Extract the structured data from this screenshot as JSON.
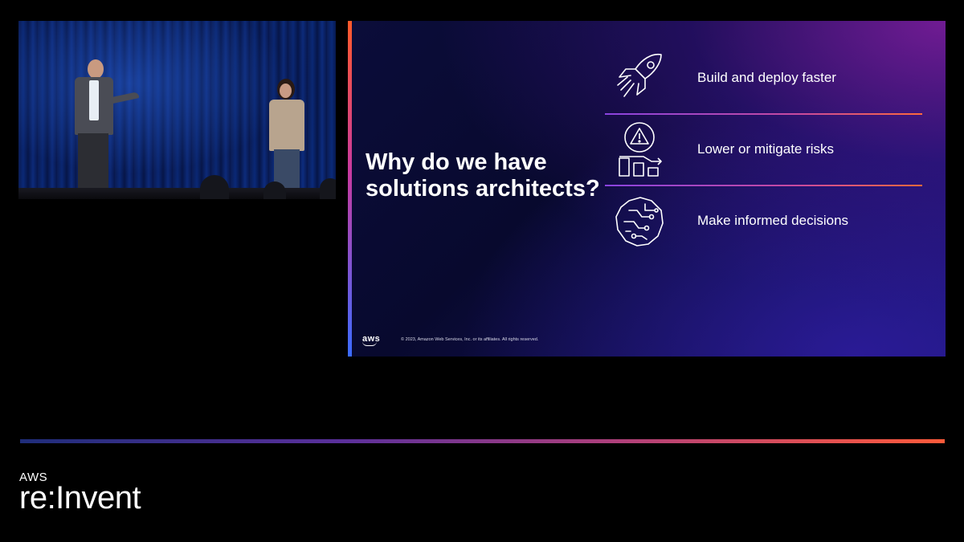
{
  "slide": {
    "title": "Why do we have solutions architects?",
    "items": [
      {
        "label": "Build and deploy faster",
        "icon": "rocket-icon"
      },
      {
        "label": "Lower or mitigate risks",
        "icon": "risk-warning-chart-icon"
      },
      {
        "label": "Make informed decisions",
        "icon": "brain-circuit-icon"
      }
    ],
    "logo": "aws",
    "copyright": "© 2023, Amazon Web Services, Inc. or its affiliates. All rights reserved."
  },
  "branding": {
    "aws": "AWS",
    "event": "re:Invent"
  },
  "colors": {
    "accent_orange": "#ff5a2a",
    "accent_purple": "#8a43e0",
    "slide_bg": "#0b0d3a"
  }
}
